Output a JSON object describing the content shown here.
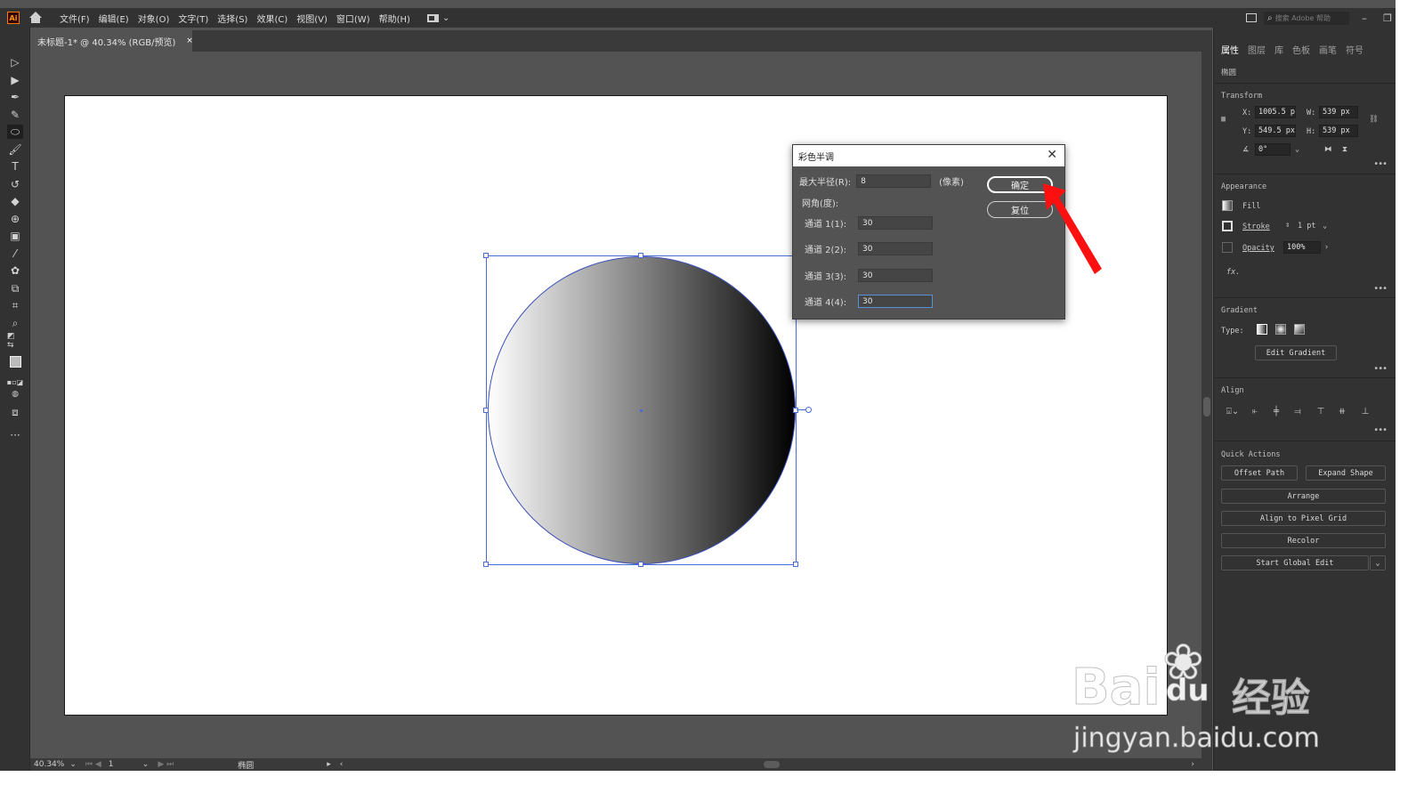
{
  "app": {
    "logo": "Ai"
  },
  "menu": [
    "文件(F)",
    "编辑(E)",
    "对象(O)",
    "文字(T)",
    "选择(S)",
    "效果(C)",
    "视图(V)",
    "窗口(W)",
    "帮助(H)"
  ],
  "search": {
    "placeholder": "搜索 Adobe 帮助"
  },
  "doc_tab": {
    "title": "未标题-1* @ 40.34% (RGB/预览)",
    "close": "×"
  },
  "dialog": {
    "title": "彩色半调",
    "max_radius_label": "最大半径(R):",
    "max_radius_value": "8",
    "unit": "(像素)",
    "screen_angle_label": "网角(度):",
    "channels": [
      {
        "label": "通道 1(1):",
        "value": "30"
      },
      {
        "label": "通道 2(2):",
        "value": "30"
      },
      {
        "label": "通道 3(3):",
        "value": "30"
      },
      {
        "label": "通道 4(4):",
        "value": "30"
      }
    ],
    "ok_label": "确定",
    "reset_label": "复位"
  },
  "statusbar": {
    "zoom": "40.34%",
    "artboard": "1",
    "tool": "椭圆"
  },
  "panel": {
    "tabs": [
      "属性",
      "图层",
      "库",
      "色板",
      "画笔",
      "符号"
    ],
    "object_type": "椭圆",
    "transform": {
      "title": "Transform",
      "x_label": "X:",
      "x_value": "1005.5 p",
      "y_label": "Y:",
      "y_value": "549.5 px",
      "w_label": "W:",
      "w_value": "539 px",
      "h_label": "H:",
      "h_value": "539 px",
      "angle_value": "0°"
    },
    "appearance": {
      "title": "Appearance",
      "fill_label": "Fill",
      "stroke_label": "Stroke",
      "stroke_value": "1 pt",
      "opacity_label": "Opacity",
      "opacity_value": "100%",
      "fx_label": "fx."
    },
    "gradient": {
      "title": "Gradient",
      "type_label": "Type:",
      "edit_button": "Edit Gradient"
    },
    "align": {
      "title": "Align"
    },
    "quick_actions": {
      "title": "Quick Actions",
      "offset_path": "Offset Path",
      "expand_shape": "Expand Shape",
      "arrange": "Arrange",
      "align_pixel": "Align to Pixel Grid",
      "recolor": "Recolor",
      "global_edit": "Start Global Edit"
    }
  },
  "watermark": {
    "brand": "Bai",
    "brand_du": "du",
    "cn": "经验",
    "url": "jingyan.baidu.com"
  },
  "colors": {
    "accent_blue": "#4a6bd6",
    "arrow_red": "#ff1010",
    "ai_orange": "#ff9a00"
  }
}
